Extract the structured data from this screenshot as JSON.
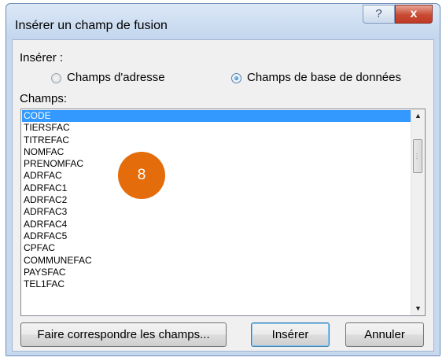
{
  "dialog": {
    "title": "Insérer un champ de fusion",
    "help_label": "?",
    "close_label": "x"
  },
  "insert_group": {
    "label": "Insérer :",
    "options": [
      {
        "label": "Champs d'adresse",
        "checked": false
      },
      {
        "label": "Champs de base de données",
        "checked": true
      }
    ]
  },
  "fields": {
    "label": "Champs:",
    "items": [
      "CODE",
      "TIERSFAC",
      "TITREFAC",
      "NOMFAC",
      "PRENOMFAC",
      "ADRFAC",
      "ADRFAC1",
      "ADRFAC2",
      "ADRFAC3",
      "ADRFAC4",
      "ADRFAC5",
      "CPFAC",
      "COMMUNEFAC",
      "PAYSFAC",
      "TEL1FAC"
    ],
    "selected_index": 0
  },
  "callout": {
    "number": "8",
    "color": "#e46c0a"
  },
  "buttons": {
    "match_fields": "Faire correspondre les champs...",
    "insert": "Insérer",
    "cancel": "Annuler"
  },
  "colors": {
    "selection": "#3399ff",
    "close_button": "#c84a33"
  }
}
